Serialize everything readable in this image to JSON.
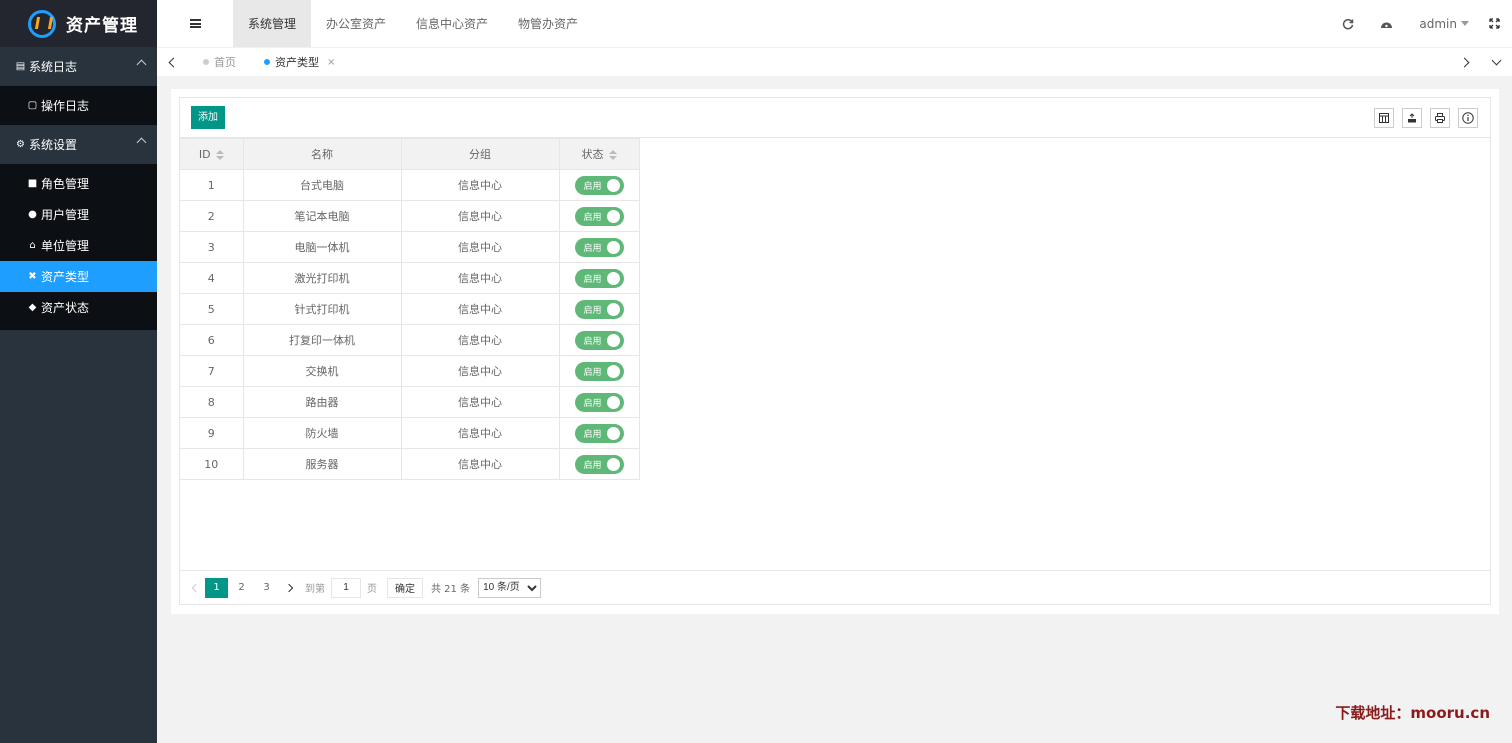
{
  "app": {
    "title": "资产管理"
  },
  "sidebar": {
    "groups": [
      {
        "label": "系统日志",
        "items": [
          {
            "label": "操作日志",
            "icon": "document-icon"
          }
        ]
      },
      {
        "label": "系统设置",
        "items": [
          {
            "label": "角色管理",
            "icon": "lock-icon"
          },
          {
            "label": "用户管理",
            "icon": "user-icon"
          },
          {
            "label": "单位管理",
            "icon": "bank-icon"
          },
          {
            "label": "资产类型",
            "icon": "asset-type-icon"
          },
          {
            "label": "资产状态",
            "icon": "cube-icon"
          }
        ]
      }
    ],
    "active_item": "资产类型"
  },
  "header": {
    "tabs": [
      "系统管理",
      "办公室资产",
      "信息中心资产",
      "物管办资产"
    ],
    "active_tab": "系统管理",
    "user": "admin"
  },
  "page_tabs": [
    {
      "label": "首页"
    },
    {
      "label": "资产类型",
      "close": "×"
    }
  ],
  "toolbar": {
    "add_label": "添加"
  },
  "table": {
    "headers": {
      "id": "ID",
      "name": "名称",
      "group": "分组",
      "status": "状态"
    },
    "rows": [
      {
        "id": "1",
        "name": "台式电脑",
        "group": "信息中心",
        "status": "启用"
      },
      {
        "id": "2",
        "name": "笔记本电脑",
        "group": "信息中心",
        "status": "启用"
      },
      {
        "id": "3",
        "name": "电脑一体机",
        "group": "信息中心",
        "status": "启用"
      },
      {
        "id": "4",
        "name": "激光打印机",
        "group": "信息中心",
        "status": "启用"
      },
      {
        "id": "5",
        "name": "针式打印机",
        "group": "信息中心",
        "status": "启用"
      },
      {
        "id": "6",
        "name": "打复印一体机",
        "group": "信息中心",
        "status": "启用"
      },
      {
        "id": "7",
        "name": "交换机",
        "group": "信息中心",
        "status": "启用"
      },
      {
        "id": "8",
        "name": "路由器",
        "group": "信息中心",
        "status": "启用"
      },
      {
        "id": "9",
        "name": "防火墙",
        "group": "信息中心",
        "status": "启用"
      },
      {
        "id": "10",
        "name": "服务器",
        "group": "信息中心",
        "status": "启用"
      }
    ]
  },
  "pager": {
    "pages": [
      "1",
      "2",
      "3"
    ],
    "current": "1",
    "goto_label": "到第",
    "goto_value": "1",
    "page_unit": "页",
    "confirm_label": "确定",
    "total_label": "共 21 条",
    "page_size": "10 条/页"
  },
  "watermark": "下载地址：mooru.cn",
  "colors": {
    "primary": "#009688",
    "accent": "#1e9fff",
    "switch_on": "#5fb878",
    "sidebar_bg": "#28333e"
  }
}
